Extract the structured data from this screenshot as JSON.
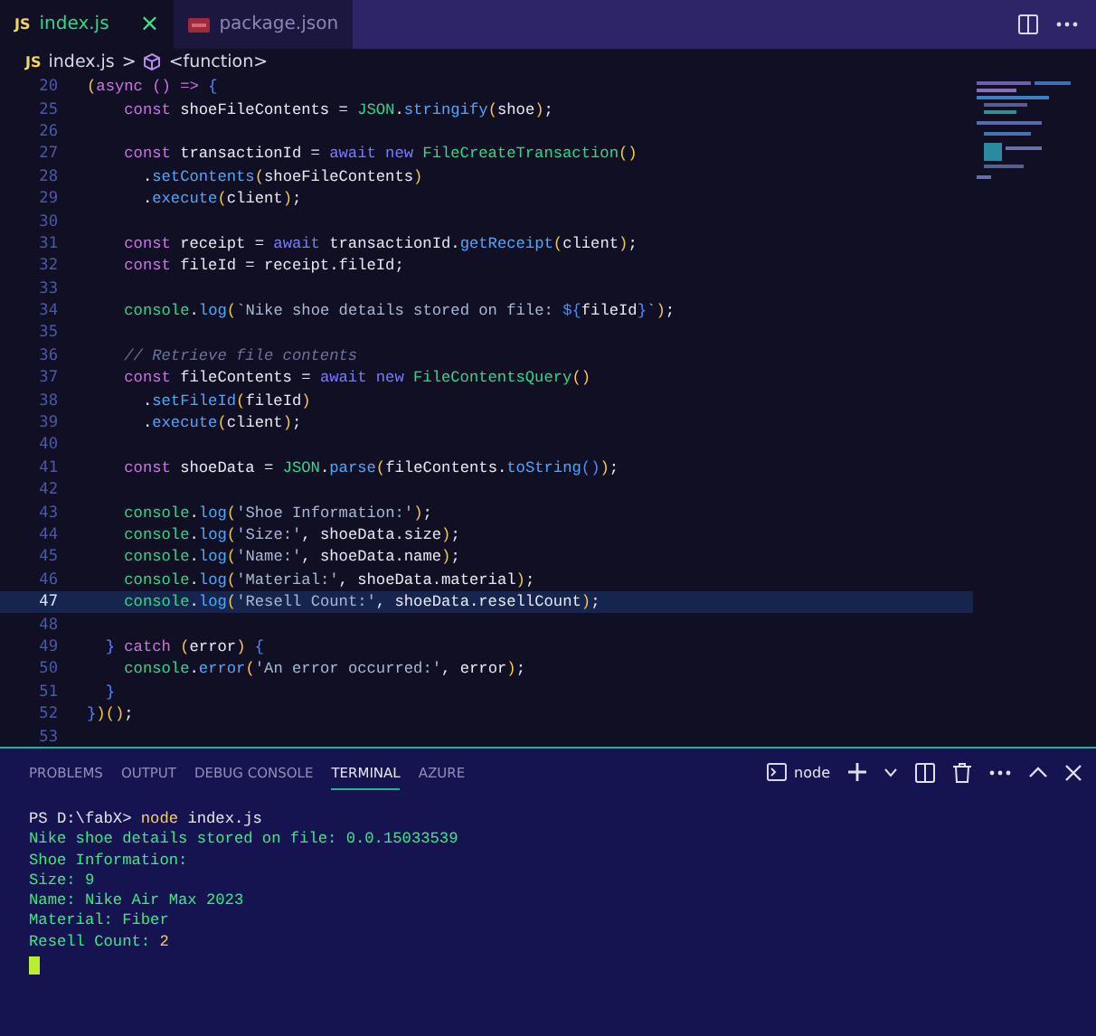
{
  "editor_tabs": [
    {
      "label": "index.js",
      "badge": "JS",
      "kind": "js",
      "selected": true,
      "close": "×"
    },
    {
      "label": "package.json",
      "kind": "json",
      "selected": false
    }
  ],
  "breadcrumb": {
    "badge": "JS",
    "file": "index.js",
    "separator": ">",
    "symbol": "<function>"
  },
  "code_lines": [
    {
      "n": "20",
      "current": false,
      "tokens": [
        {
          "kind": "paren",
          "text": "("
        },
        {
          "kind": "keyword",
          "text": "async"
        },
        {
          "kind": "keyword",
          "text": " ()"
        },
        {
          "kind": "keyword",
          "text": " =>"
        },
        {
          "kind": "brace",
          "text": " {"
        }
      ]
    },
    {
      "n": "25",
      "current": false,
      "tokens": [
        {
          "kind": "keyword",
          "text": "    const"
        },
        {
          "kind": "plain",
          "text": " shoeFileContents = "
        },
        {
          "kind": "class",
          "text": "JSON"
        },
        {
          "kind": "plain",
          "text": "."
        },
        {
          "kind": "method",
          "text": "stringify"
        },
        {
          "kind": "paren",
          "text": "("
        },
        {
          "kind": "plain",
          "text": "shoe"
        },
        {
          "kind": "paren",
          "text": ")"
        },
        {
          "kind": "plain",
          "text": ";"
        }
      ]
    },
    {
      "n": "26",
      "current": false
    },
    {
      "n": "27",
      "current": false,
      "tokens": [
        {
          "kind": "keyword",
          "text": "    const"
        },
        {
          "kind": "plain",
          "text": " transactionId = "
        },
        {
          "kind": "control",
          "text": "await new"
        },
        {
          "kind": "class",
          "text": " FileCreateTransaction"
        },
        {
          "kind": "paren",
          "text": "()"
        }
      ]
    },
    {
      "n": "28",
      "current": false,
      "tokens": [
        {
          "kind": "plain",
          "text": "      ."
        },
        {
          "kind": "method",
          "text": "setContents"
        },
        {
          "kind": "paren",
          "text": "("
        },
        {
          "kind": "plain",
          "text": "shoeFileContents"
        },
        {
          "kind": "paren",
          "text": ")"
        }
      ]
    },
    {
      "n": "29",
      "current": false,
      "tokens": [
        {
          "kind": "plain",
          "text": "      ."
        },
        {
          "kind": "method",
          "text": "execute"
        },
        {
          "kind": "paren",
          "text": "("
        },
        {
          "kind": "plain",
          "text": "client"
        },
        {
          "kind": "paren",
          "text": ")"
        },
        {
          "kind": "plain",
          "text": ";"
        }
      ]
    },
    {
      "n": "30",
      "current": false
    },
    {
      "n": "31",
      "current": false,
      "tokens": [
        {
          "kind": "keyword",
          "text": "    const"
        },
        {
          "kind": "plain",
          "text": " receipt = "
        },
        {
          "kind": "control",
          "text": "await"
        },
        {
          "kind": "plain",
          "text": " transactionId."
        },
        {
          "kind": "method",
          "text": "getReceipt"
        },
        {
          "kind": "paren",
          "text": "("
        },
        {
          "kind": "plain",
          "text": "client"
        },
        {
          "kind": "paren",
          "text": ")"
        },
        {
          "kind": "plain",
          "text": ";"
        }
      ]
    },
    {
      "n": "32",
      "current": false,
      "tokens": [
        {
          "kind": "keyword",
          "text": "    const"
        },
        {
          "kind": "plain",
          "text": " fileId = receipt.fileId;"
        }
      ]
    },
    {
      "n": "33",
      "current": false
    },
    {
      "n": "34",
      "current": false,
      "tokens": [
        {
          "kind": "class",
          "text": "    console"
        },
        {
          "kind": "plain",
          "text": "."
        },
        {
          "kind": "method",
          "text": "log"
        },
        {
          "kind": "paren",
          "text": "("
        },
        {
          "kind": "string",
          "text": "`Nike shoe details stored on file: "
        },
        {
          "kind": "brace",
          "text": "${"
        },
        {
          "kind": "plain",
          "text": "fileId"
        },
        {
          "kind": "brace",
          "text": "}"
        },
        {
          "kind": "string",
          "text": "`"
        },
        {
          "kind": "paren",
          "text": ")"
        },
        {
          "kind": "plain",
          "text": ";"
        }
      ]
    },
    {
      "n": "35",
      "current": false
    },
    {
      "n": "36",
      "current": false,
      "tokens": [
        {
          "kind": "comment",
          "text": "    // Retrieve file contents"
        }
      ]
    },
    {
      "n": "37",
      "current": false,
      "tokens": [
        {
          "kind": "keyword",
          "text": "    const"
        },
        {
          "kind": "plain",
          "text": " fileContents = "
        },
        {
          "kind": "control",
          "text": "await new"
        },
        {
          "kind": "class",
          "text": " FileContentsQuery"
        },
        {
          "kind": "paren",
          "text": "()"
        }
      ]
    },
    {
      "n": "38",
      "current": false,
      "tokens": [
        {
          "kind": "plain",
          "text": "      ."
        },
        {
          "kind": "method",
          "text": "setFileId"
        },
        {
          "kind": "paren",
          "text": "("
        },
        {
          "kind": "plain",
          "text": "fileId"
        },
        {
          "kind": "paren",
          "text": ")"
        }
      ]
    },
    {
      "n": "39",
      "current": false,
      "tokens": [
        {
          "kind": "plain",
          "text": "      ."
        },
        {
          "kind": "method",
          "text": "execute"
        },
        {
          "kind": "paren",
          "text": "("
        },
        {
          "kind": "plain",
          "text": "client"
        },
        {
          "kind": "paren",
          "text": ")"
        },
        {
          "kind": "plain",
          "text": ";"
        }
      ]
    },
    {
      "n": "40",
      "current": false
    },
    {
      "n": "41",
      "current": false,
      "tokens": [
        {
          "kind": "keyword",
          "text": "    const"
        },
        {
          "kind": "plain",
          "text": " shoeData = "
        },
        {
          "kind": "class",
          "text": "JSON"
        },
        {
          "kind": "plain",
          "text": "."
        },
        {
          "kind": "method",
          "text": "parse"
        },
        {
          "kind": "paren",
          "text": "("
        },
        {
          "kind": "plain",
          "text": "fileContents."
        },
        {
          "kind": "method",
          "text": "toString"
        },
        {
          "kind": "brace",
          "text": "()"
        },
        {
          "kind": "paren",
          "text": ")"
        },
        {
          "kind": "plain",
          "text": ";"
        }
      ]
    },
    {
      "n": "42",
      "current": false
    },
    {
      "n": "43",
      "current": false,
      "tokens": [
        {
          "kind": "class",
          "text": "    console"
        },
        {
          "kind": "plain",
          "text": "."
        },
        {
          "kind": "method",
          "text": "log"
        },
        {
          "kind": "paren",
          "text": "("
        },
        {
          "kind": "string",
          "text": "'Shoe Information:'"
        },
        {
          "kind": "paren",
          "text": ")"
        },
        {
          "kind": "plain",
          "text": ";"
        }
      ]
    },
    {
      "n": "44",
      "current": false,
      "tokens": [
        {
          "kind": "class",
          "text": "    console"
        },
        {
          "kind": "plain",
          "text": "."
        },
        {
          "kind": "method",
          "text": "log"
        },
        {
          "kind": "paren",
          "text": "("
        },
        {
          "kind": "string",
          "text": "'Size:'"
        },
        {
          "kind": "plain",
          "text": ", shoeData.size"
        },
        {
          "kind": "paren",
          "text": ")"
        },
        {
          "kind": "plain",
          "text": ";"
        }
      ]
    },
    {
      "n": "45",
      "current": false,
      "tokens": [
        {
          "kind": "class",
          "text": "    console"
        },
        {
          "kind": "plain",
          "text": "."
        },
        {
          "kind": "method",
          "text": "log"
        },
        {
          "kind": "paren",
          "text": "("
        },
        {
          "kind": "string",
          "text": "'Name:'"
        },
        {
          "kind": "plain",
          "text": ", shoeData.name"
        },
        {
          "kind": "paren",
          "text": ")"
        },
        {
          "kind": "plain",
          "text": ";"
        }
      ]
    },
    {
      "n": "46",
      "current": false,
      "tokens": [
        {
          "kind": "class",
          "text": "    console"
        },
        {
          "kind": "plain",
          "text": "."
        },
        {
          "kind": "method",
          "text": "log"
        },
        {
          "kind": "paren",
          "text": "("
        },
        {
          "kind": "string",
          "text": "'Material:'"
        },
        {
          "kind": "plain",
          "text": ", shoeData.material"
        },
        {
          "kind": "paren",
          "text": ")"
        },
        {
          "kind": "plain",
          "text": ";"
        }
      ]
    },
    {
      "n": "47",
      "current": true,
      "tokens": [
        {
          "kind": "class",
          "text": "    console"
        },
        {
          "kind": "plain",
          "text": "."
        },
        {
          "kind": "method",
          "text": "log"
        },
        {
          "kind": "paren",
          "text": "("
        },
        {
          "kind": "string",
          "text": "'Resell Count:'"
        },
        {
          "kind": "plain",
          "text": ", shoeData.resellCount"
        },
        {
          "kind": "paren",
          "text": ")"
        },
        {
          "kind": "plain",
          "text": ";"
        }
      ]
    },
    {
      "n": "48",
      "current": false
    },
    {
      "n": "49",
      "current": false,
      "tokens": [
        {
          "kind": "brace",
          "text": "  }"
        },
        {
          "kind": "keyword",
          "text": " catch"
        },
        {
          "kind": "paren",
          "text": " ("
        },
        {
          "kind": "plain",
          "text": "error"
        },
        {
          "kind": "paren",
          "text": ")"
        },
        {
          "kind": "brace",
          "text": " {"
        }
      ]
    },
    {
      "n": "50",
      "current": false,
      "tokens": [
        {
          "kind": "class",
          "text": "    console"
        },
        {
          "kind": "plain",
          "text": "."
        },
        {
          "kind": "method",
          "text": "error"
        },
        {
          "kind": "paren",
          "text": "("
        },
        {
          "kind": "string",
          "text": "'An error occurred:'"
        },
        {
          "kind": "plain",
          "text": ", error"
        },
        {
          "kind": "paren",
          "text": ")"
        },
        {
          "kind": "plain",
          "text": ";"
        }
      ]
    },
    {
      "n": "51",
      "current": false,
      "tokens": [
        {
          "kind": "brace",
          "text": "  }"
        }
      ]
    },
    {
      "n": "52",
      "current": false,
      "tokens": [
        {
          "kind": "brace",
          "text": "}"
        },
        {
          "kind": "paren",
          "text": ")()"
        },
        {
          "kind": "plain",
          "text": ";"
        }
      ]
    },
    {
      "n": "53",
      "current": false
    }
  ],
  "panel_tabs": [
    {
      "label": "PROBLEMS",
      "selected": false
    },
    {
      "label": "OUTPUT",
      "selected": false
    },
    {
      "label": "DEBUG CONSOLE",
      "selected": false
    },
    {
      "label": "TERMINAL",
      "selected": true
    },
    {
      "label": "AZURE",
      "selected": false
    }
  ],
  "terminal_name": "node",
  "terminal_lines": [
    [
      {
        "kind": "prompt",
        "text": "PS D:\\fabX> "
      },
      {
        "kind": "command",
        "text": "node"
      },
      {
        "kind": "prompt",
        "text": " index.js"
      }
    ],
    [
      {
        "kind": "output",
        "text": "Nike shoe details stored on file: 0.0.15033539"
      }
    ],
    [
      {
        "kind": "output",
        "text": "Shoe Information:"
      }
    ],
    [
      {
        "kind": "output",
        "text": "Size: 9"
      }
    ],
    [
      {
        "kind": "output",
        "text": "Name: Nike Air Max 2023"
      }
    ],
    [
      {
        "kind": "output",
        "text": "Material: Fiber"
      }
    ],
    [
      {
        "kind": "output",
        "text": "Resell Count: "
      },
      {
        "kind": "number",
        "text": "2"
      }
    ]
  ]
}
